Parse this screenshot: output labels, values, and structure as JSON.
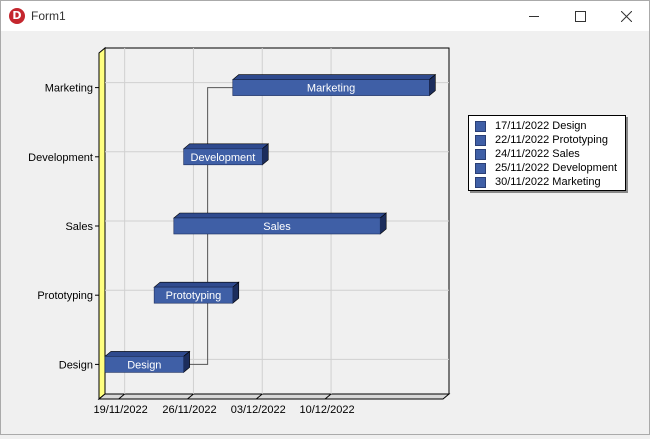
{
  "window": {
    "title": "Form1"
  },
  "colors": {
    "bar_face": "#3f5fa6",
    "bar_top": "#2f4a8e",
    "bar_side": "#1c2d5c",
    "wall": "#ffff80",
    "plot_bg": "#f0f0f0",
    "grid": "#d0d0d0",
    "connector": "#555555"
  },
  "legend": {
    "items": [
      "17/11/2022 Design",
      "22/11/2022 Prototyping",
      "24/11/2022 Sales",
      "25/11/2022 Development",
      "30/11/2022 Marketing"
    ]
  },
  "chart_data": {
    "type": "gantt",
    "categories": [
      "Design",
      "Prototyping",
      "Sales",
      "Development",
      "Marketing"
    ],
    "tasks": [
      {
        "label": "Design",
        "start": "2022-11-17",
        "end": "2022-11-25"
      },
      {
        "label": "Prototyping",
        "start": "2022-11-22",
        "end": "2022-11-30"
      },
      {
        "label": "Sales",
        "start": "2022-11-24",
        "end": "2022-12-15"
      },
      {
        "label": "Development",
        "start": "2022-11-25",
        "end": "2022-12-03"
      },
      {
        "label": "Marketing",
        "start": "2022-11-30",
        "end": "2022-12-20"
      }
    ],
    "connectors": [
      [
        "Design",
        "Marketing"
      ]
    ],
    "x_ticks": [
      {
        "date": "2022-11-19",
        "label": "19/11/2022"
      },
      {
        "date": "2022-11-26",
        "label": "26/11/2022"
      },
      {
        "date": "2022-12-03",
        "label": "03/12/2022"
      },
      {
        "date": "2022-12-10",
        "label": "10/12/2022"
      }
    ],
    "xlim": [
      "2022-11-17",
      "2022-12-22"
    ],
    "grid": true,
    "legend_position": "right"
  }
}
